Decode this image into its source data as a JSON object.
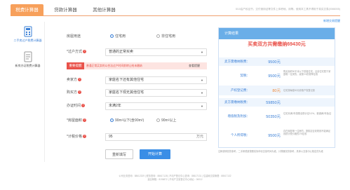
{
  "tabs": [
    {
      "label": "税费计算器",
      "active": true
    },
    {
      "label": "贷款计算器",
      "active": false
    },
    {
      "label": "其他计算器",
      "active": false
    }
  ],
  "tab_note": "5/10由产权证书、交付使用证等文件上体积地、用等。使用本工具不得用于真实交易(0086005)",
  "help_link": "新增交易提醒",
  "sidebar": [
    {
      "label": "二手房过户税费计算器",
      "icon": "calculator-icon",
      "active": true
    },
    {
      "label": "新房办证税费计算器",
      "icon": "document-icon",
      "active": false
    }
  ],
  "form": {
    "usage": {
      "label": "房屋用途",
      "options": [
        "住宅用",
        "非住宅用"
      ],
      "selected": 0
    },
    "transfer": {
      "label": "*过户方式",
      "value": "普通的正常买卖"
    },
    "warning": {
      "tag": "重要提醒",
      "text": "普通正常买卖的以合法过户时间前转让给未缴纳",
      "more": "查看提醒"
    },
    "seller": {
      "label": "卖家方",
      "value": "家庭名下还有其他住宅"
    },
    "buyer": {
      "label": "购买方",
      "value": "家庭名下现无其他住宅"
    },
    "hold": {
      "label": "办证时间",
      "value": "未满2年"
    },
    "area": {
      "label": "*房屋面积",
      "options": [
        "90m²以下(含90m²)",
        "90m²以上"
      ],
      "selected": 0
    },
    "price": {
      "label": "*计税价格",
      "value": "95",
      "unit": "万元"
    },
    "reset_label": "重新填写",
    "calc_label": "开始计算"
  },
  "result": {
    "header": "计算结果",
    "total": "买卖双方共需缴纳69430元",
    "rows": [
      {
        "k": "卖方需缴纳税费：",
        "v": "9500元",
        "desc": "",
        "band": true
      },
      {
        "k": "契税：",
        "v": "9500元",
        "desc": "购买面积90平米以下首套住宅，且该住宅属于家庭唯一住房的，减按1%的税率征收",
        "band": false
      },
      {
        "k": "卖方需缴纳税费：",
        "v": "59850元",
        "desc": "",
        "band": true
      },
      {
        "k": "增值税及附加：",
        "v": "50350元",
        "desc": "住宅未满2年按照全额计征5.3%，普通满2年免征",
        "band": false
      },
      {
        "k": "个人所得税：",
        "v": "9500元",
        "desc": "存在家庭唯一住房的，按核定征收规则不能满足则按计税价格的1%征收",
        "band": false
      }
    ],
    "extra_row": {
      "k": "产权登记费：",
      "v": "80元",
      "desc": "住宅按每套80元收取产权登记费"
    }
  },
  "tip": "注释说明仅供参考，二手房税费按照实际申请交易时间为准，计算器仅供参考，具体以交易中心核定的为准",
  "footer": [
    "公司业务咨询：88612329 | 税务咨询：88617128 | 不动产登记中心咨询：88617131 | 住建局交易管理：88617132",
    "建议邮箱：8196872 | 不动产交易登记中心地址：06012"
  ],
  "colors": {
    "accent": "#f7a05b",
    "primary": "#3a8ee6",
    "warn": "#e9524a"
  }
}
